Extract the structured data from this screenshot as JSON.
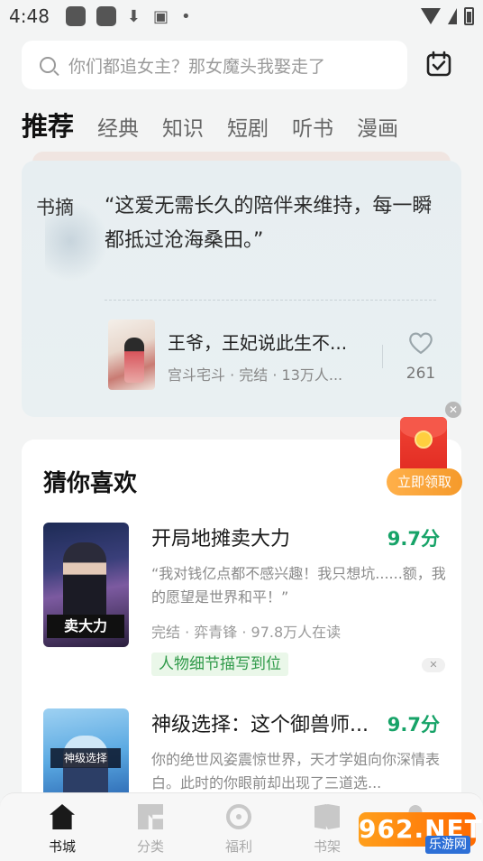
{
  "status_bar": {
    "time": "4:48"
  },
  "search": {
    "placeholder_text": "你们都追女主？那女魔头我娶走了"
  },
  "tabs": [
    {
      "label": "推荐",
      "active": true
    },
    {
      "label": "经典",
      "active": false
    },
    {
      "label": "知识",
      "active": false
    },
    {
      "label": "短剧",
      "active": false
    },
    {
      "label": "听书",
      "active": false
    },
    {
      "label": "漫画",
      "active": false
    }
  ],
  "quote": {
    "label": "书摘",
    "text": "“这爱无需长久的陪伴来维持，每一瞬都抵过沧海桑田。”",
    "book_title": "王爷，王妃说此生不...",
    "book_meta": "宫斗宅斗 · 完结 · 13万人...",
    "likes": "261"
  },
  "red_packet": {
    "button_label": "立即领取"
  },
  "recommend": {
    "title": "猜你喜欢",
    "books": [
      {
        "title": "开局地摊卖大力",
        "score": "9.7分",
        "desc": "“我对钱亿点都不感兴趣！我只想坑......额，我的愿望是世界和平！”",
        "meta": "完结 · 弈青锋 · 97.8万人在读",
        "tag": "人物细节描写到位",
        "cover_text": "卖大力"
      },
      {
        "title": "神级选择：这个御兽师...",
        "score": "9.7分",
        "desc": "你的绝世风姿震惊世界，天才学姐向你深情表白。此时的你眼前却出现了三道选...",
        "cover_text": "神级选择"
      }
    ]
  },
  "bottom_nav": [
    {
      "label": "书城",
      "active": true,
      "icon": "home-icon"
    },
    {
      "label": "分类",
      "active": false,
      "icon": "category-icon"
    },
    {
      "label": "福利",
      "active": false,
      "icon": "welfare-icon"
    },
    {
      "label": "书架",
      "active": false,
      "icon": "bookshelf-icon"
    }
  ],
  "watermark": {
    "text": "962.NET",
    "sub": "乐游网"
  },
  "colors": {
    "score_green": "#17a368",
    "tag_green": "#2f9a49",
    "red_packet_orange": "#f59a2b"
  }
}
